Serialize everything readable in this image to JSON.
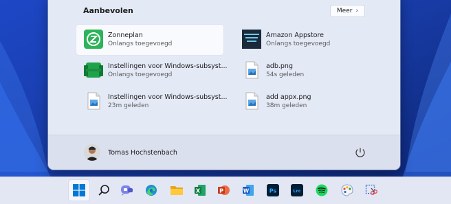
{
  "start_menu": {
    "section_title": "Aanbevolen",
    "more_button": "Meer",
    "recommended": [
      {
        "name": "Zonneplan",
        "subtitle": "Onlangs toegevoegd",
        "icon": "zonneplan-app-icon"
      },
      {
        "name": "Amazon Appstore",
        "subtitle": "Onlangs toegevoegd",
        "icon": "amazon-appstore-icon"
      },
      {
        "name": "Instellingen voor Windows-subsyst...",
        "subtitle": "Onlangs toegevoegd",
        "icon": "wsa-settings-icon"
      },
      {
        "name": "adb.png",
        "subtitle": "54s geleden",
        "icon": "image-file-icon"
      },
      {
        "name": "Instellingen voor Windows-subsyst...",
        "subtitle": "23m geleden",
        "icon": "image-file-icon"
      },
      {
        "name": "add appx.png",
        "subtitle": "38m geleden",
        "icon": "image-file-icon"
      }
    ],
    "user": {
      "name": "Tomas Hochstenbach"
    }
  },
  "taskbar": {
    "apps": [
      {
        "name": "start",
        "icon": "windows-logo-icon"
      },
      {
        "name": "search",
        "icon": "search-icon"
      },
      {
        "name": "chat",
        "icon": "teams-chat-icon"
      },
      {
        "name": "edge",
        "icon": "edge-icon"
      },
      {
        "name": "explorer",
        "icon": "folder-icon"
      },
      {
        "name": "excel",
        "icon": "excel-icon",
        "label": "X"
      },
      {
        "name": "powerpoint",
        "icon": "powerpoint-icon",
        "label": "P"
      },
      {
        "name": "word",
        "icon": "word-icon",
        "label": "W"
      },
      {
        "name": "photoshop",
        "icon": "photoshop-icon",
        "label": "Ps"
      },
      {
        "name": "lightroom",
        "icon": "lightroom-classic-icon",
        "label": "Lrc"
      },
      {
        "name": "spotify",
        "icon": "spotify-icon"
      },
      {
        "name": "paint",
        "icon": "paint-icon"
      },
      {
        "name": "snipping-tool",
        "icon": "snipping-tool-icon"
      }
    ]
  },
  "colors": {
    "accent": "#0067c0",
    "menu_bg": "#e4e9f6",
    "wallpaper": "#1c3a9e"
  }
}
